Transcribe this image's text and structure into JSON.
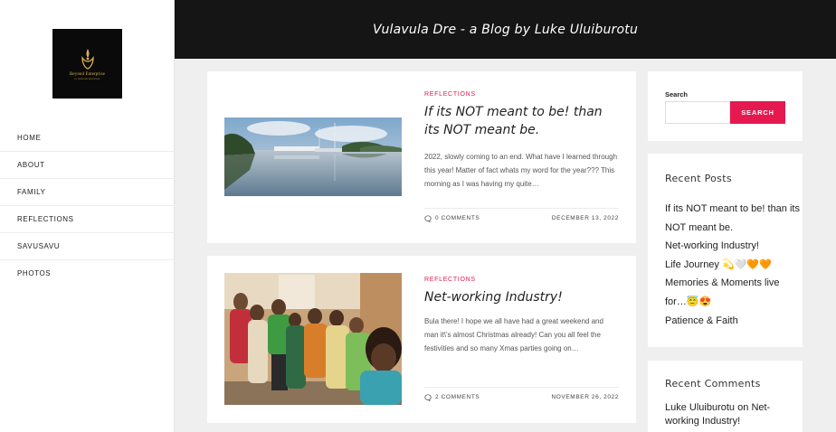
{
  "site": {
    "title": "Vulavula Dre - a Blog by Luke Uluiburotu",
    "logo": {
      "name": "Beyond Enterprise",
      "tagline": "by Uluiburotu Enterprises"
    }
  },
  "nav": [
    {
      "label": "HOME"
    },
    {
      "label": "ABOUT"
    },
    {
      "label": "FAMILY"
    },
    {
      "label": "REFLECTIONS"
    },
    {
      "label": "SAVUSAVU"
    },
    {
      "label": "PHOTOS"
    }
  ],
  "posts": [
    {
      "category": "REFLECTIONS",
      "title": "If its NOT meant to be! than its NOT meant be.",
      "excerpt": "2022, slowly coming to an end. What have I learned through this year! Matter of fact whats my word for the year??? This morning as I was having my quite…",
      "comments": "0 COMMENTS",
      "date": "DECEMBER 13, 2022",
      "image": "harbour-photo"
    },
    {
      "category": "REFLECTIONS",
      "title": "Net-working Industry!",
      "excerpt": "Bula there! I hope we all have had a great weekend and man it\\'s almost Christmas already! Can you all feel the festivities and so many Xmas parties going on…",
      "comments": "2 COMMENTS",
      "date": "NOVEMBER 26, 2022",
      "image": "group-photo"
    }
  ],
  "search": {
    "label": "Search",
    "value": "",
    "button": "SEARCH"
  },
  "recent_posts": {
    "title": "Recent Posts",
    "items": [
      "If its NOT meant to be! than its NOT meant be.",
      "Net-working Industry!",
      "Life Journey 💫🤍🧡🧡",
      "Memories & Moments live for…😇😍",
      "Patience & Faith"
    ]
  },
  "recent_comments": {
    "title": "Recent Comments",
    "author": "Luke Uluiburotu",
    "on": "on",
    "post": "Net-working Industry!"
  },
  "colors": {
    "accent": "#e5194f",
    "header": "#151515",
    "background": "#efefef"
  }
}
